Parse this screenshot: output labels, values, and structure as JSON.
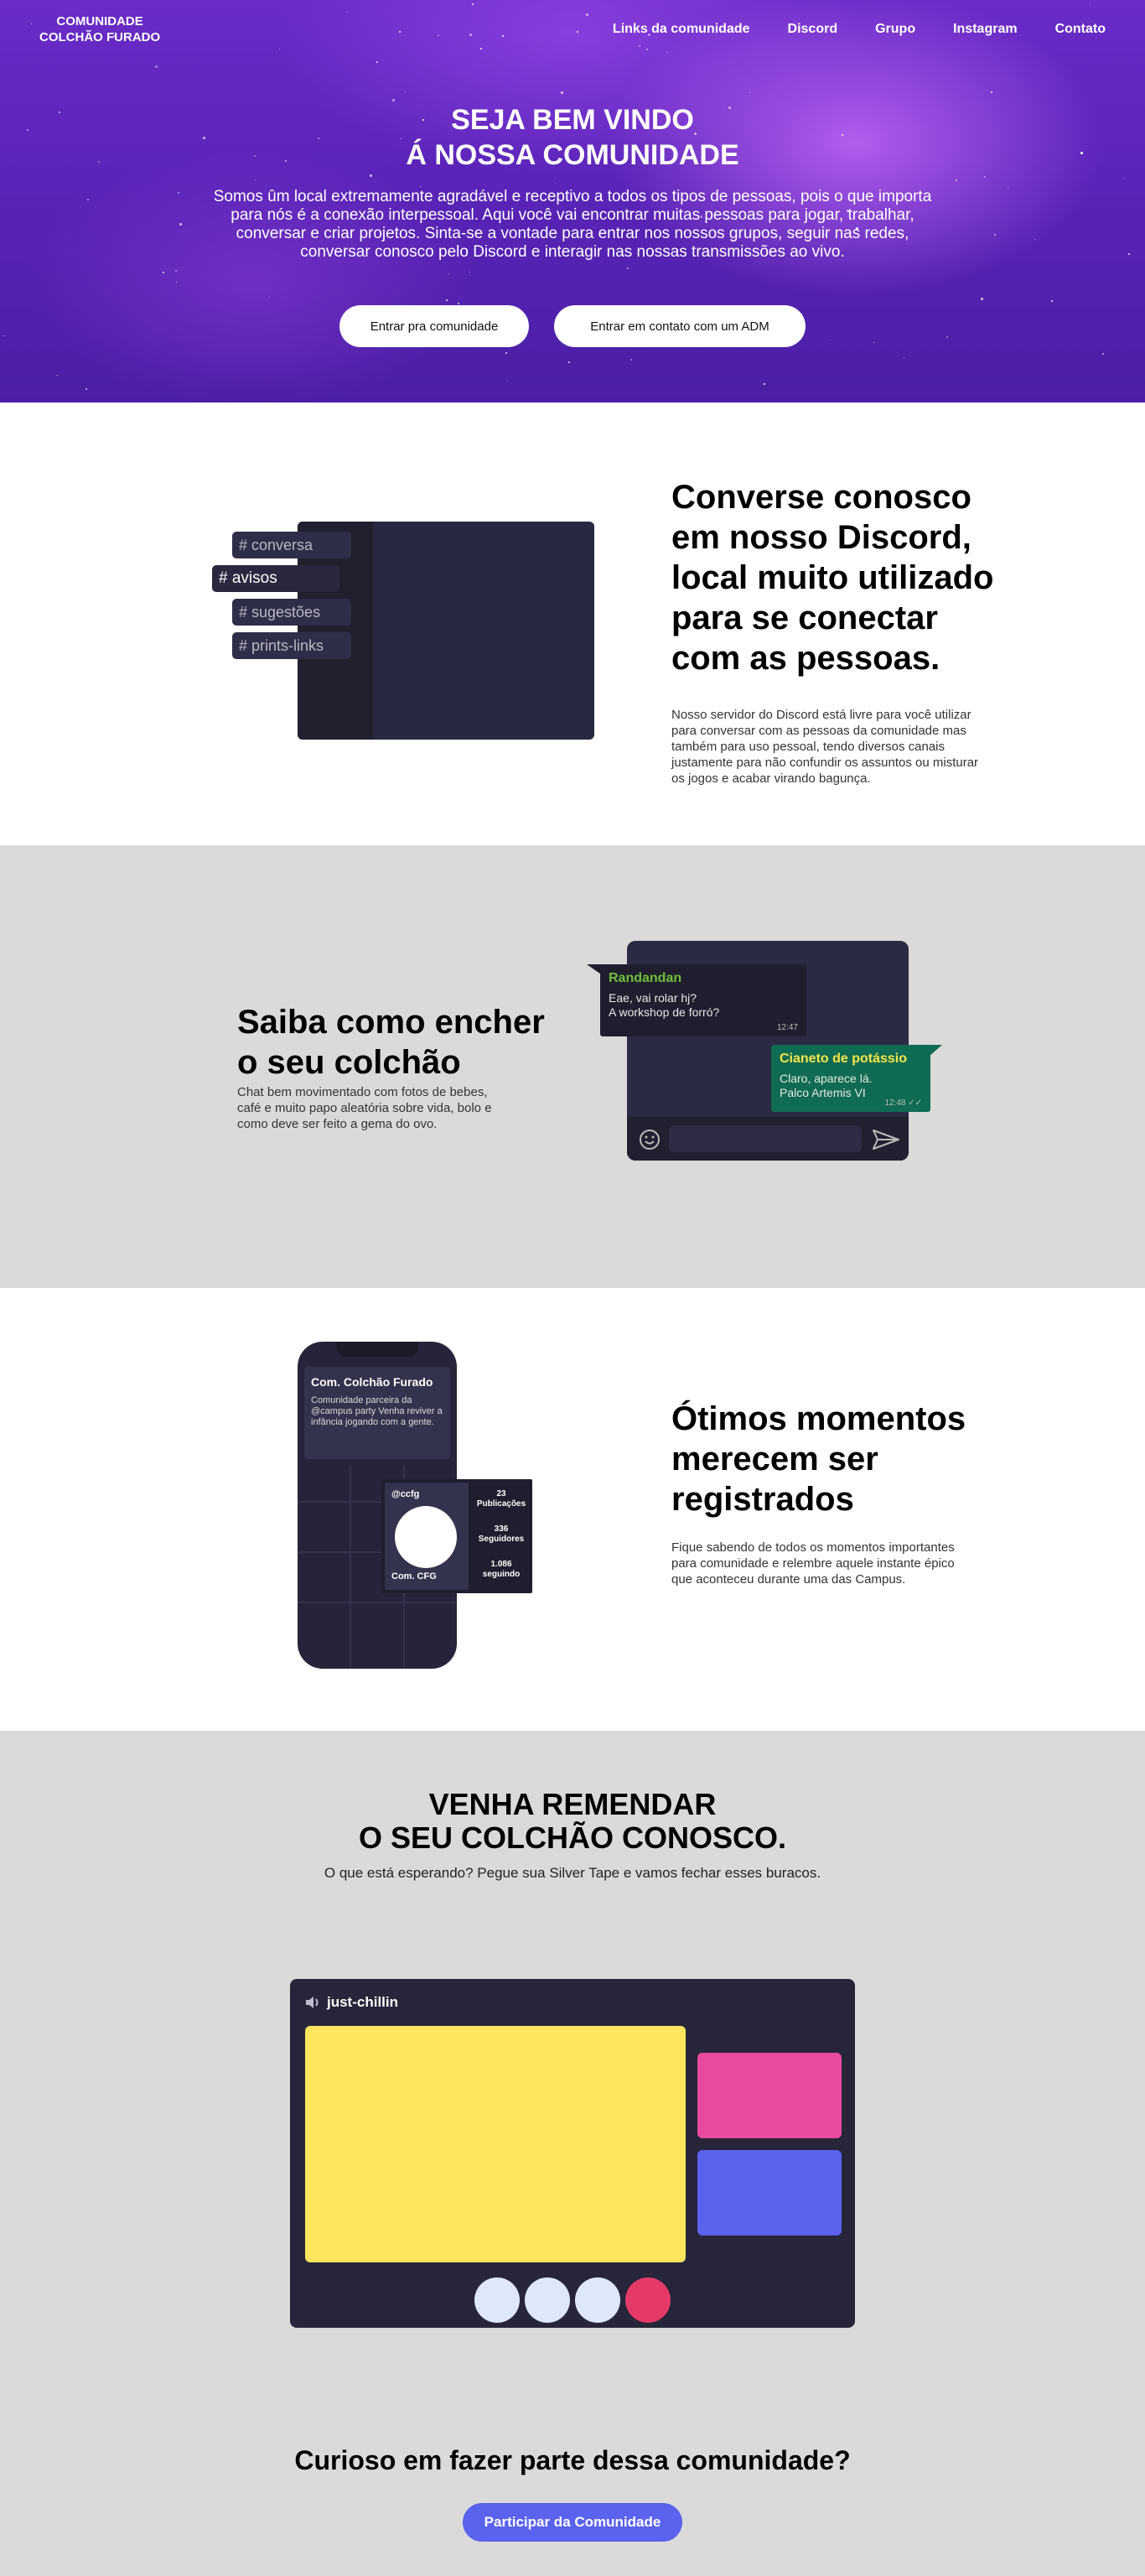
{
  "nav": {
    "logo_line1": "COMUNIDADE",
    "logo_line2": "COLCHÃO FURADO",
    "links": [
      "Links da comunidade",
      "Discord",
      "Grupo",
      "Instagram",
      "Contato"
    ]
  },
  "hero": {
    "title_line1": "SEJA BEM VINDO",
    "title_line2": "Á NOSSA COMUNIDADE",
    "text": "Somos ûm local extremamente agradável e receptivo a todos os tipos de pessoas, pois o que importa para nós é a conexão interpessoal. Aqui você vai encontrar muitas pessoas para jogar, trabalhar, conversar e criar projetos. Sinta-se a vontade para entrar nos nossos grupos, seguir nas redes, conversar conosco pelo Discord e interagir nas nossas transmissões ao vivo.",
    "button_join": "Entrar pra comunidade",
    "button_contact": "Entrar em contato com um ADM"
  },
  "discord": {
    "channels": [
      "# conversa",
      "# avisos",
      "# sugestões",
      "# prints-links"
    ],
    "title": "Converse conosco em nosso Discord, local muito utilizado para se conectar com as pessoas.",
    "text": "Nosso servidor do Discord está livre para você utilizar para conversar com as pessoas da comunidade mas também para uso pessoal, tendo diversos canais justamente para não confundir os assuntos ou misturar os jogos e acabar virando bagunça."
  },
  "chat": {
    "title_line1": "Saiba como encher",
    "title_line2": "o seu colchão",
    "text": "Chat bem movimentado com fotos de bebes, café e muito papo aleatória sobre vida, bolo e como deve ser feito a gema do ovo.",
    "msg1": {
      "name": "Randandan",
      "line1": "Eae, vai rolar hj?",
      "line2": "A workshop de forró?",
      "time": "12:47"
    },
    "msg2": {
      "name": "Cianeto de potássio",
      "line1": "Claro, aparece lá.",
      "line2": "Palco Artemis VI",
      "time": "12:48 ✓✓"
    }
  },
  "insta": {
    "card_title": "Com. Colchão Furado",
    "card_desc": "Comunidade parceira da @campus party Venha reviver a infância jogando com a gente.",
    "handle": "@ccfg",
    "profile_name": "Com. CFG",
    "stat1_num": "23",
    "stat1_label": "Publicações",
    "stat2_num": "336",
    "stat2_label": "Seguidores",
    "stat3_num": "1.086",
    "stat3_label": "seguindo",
    "title": "Ótimos momentos merecem ser registrados",
    "text": "Fique sabendo de todos os momentos importantes para comunidade e relembre aquele instante épico que aconteceu durante uma das Campus."
  },
  "final": {
    "title_line1": "VENHA REMENDAR",
    "title_line2": "O SEU COLCHÃO CONOSCO.",
    "subtitle": "O que está esperando? Pegue sua Silver Tape e vamos fechar esses buracos.",
    "voice_channel": "just-chillin",
    "cta_title": "Curioso em fazer parte dessa comunidade?",
    "cta_button": "Participar da Comunidade"
  },
  "colors": {
    "accent": "#5a62ee",
    "hero_purple": "#6a2bc7",
    "dark_panel": "#292841",
    "yellow": "#fde55e",
    "pink": "#ea4a9d",
    "red": "#e53a67"
  }
}
